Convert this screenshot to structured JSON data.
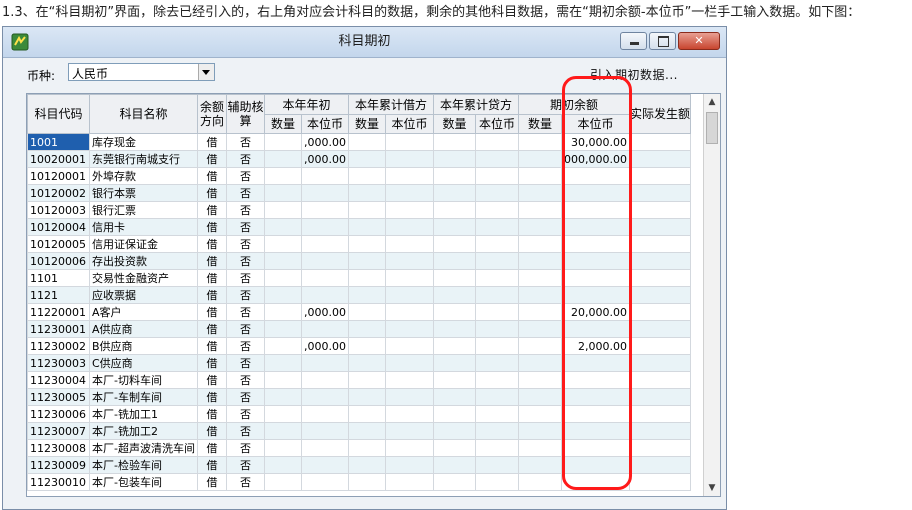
{
  "caption": "1.3、在“科目期初”界面，除去已经引入的，右上角对应会计科目的数据，剩余的其他科目数据，需在“期初余额-本位币”一栏手工输入数据。如下图：",
  "window": {
    "title": "科目期初",
    "buttons": {
      "minimize": "—",
      "maximize": "□",
      "close": "✕"
    }
  },
  "toolbar": {
    "currency_label": "币种:",
    "currency_value": "人民币",
    "import_link": "引入期初数据..."
  },
  "table": {
    "headers": {
      "code": "科目代码",
      "name": "科目名称",
      "direction": "余额方向",
      "aux": "辅助核算",
      "year_begin": "本年年初",
      "ytd_debit": "本年累计借方",
      "ytd_credit": "本年累计贷方",
      "opening": "期初余额",
      "actual": "实际发生额",
      "qty": "数量",
      "base": "本位币"
    },
    "rows": [
      {
        "code": "1001",
        "name": "库存现金",
        "dir": "借",
        "aux": "否",
        "yb": ",000.00",
        "ob": "30,000.00"
      },
      {
        "code": "10020001",
        "name": "东莞银行南城支行",
        "dir": "借",
        "aux": "否",
        "yb": ",000.00",
        "ob": "000,000.00"
      },
      {
        "code": "10120001",
        "name": "外埠存款",
        "dir": "借",
        "aux": "否",
        "yb": "",
        "ob": ""
      },
      {
        "code": "10120002",
        "name": "银行本票",
        "dir": "借",
        "aux": "否",
        "yb": "",
        "ob": ""
      },
      {
        "code": "10120003",
        "name": "银行汇票",
        "dir": "借",
        "aux": "否",
        "yb": "",
        "ob": ""
      },
      {
        "code": "10120004",
        "name": "信用卡",
        "dir": "借",
        "aux": "否",
        "yb": "",
        "ob": ""
      },
      {
        "code": "10120005",
        "name": "信用证保证金",
        "dir": "借",
        "aux": "否",
        "yb": "",
        "ob": ""
      },
      {
        "code": "10120006",
        "name": "存出投资款",
        "dir": "借",
        "aux": "否",
        "yb": "",
        "ob": ""
      },
      {
        "code": "1101",
        "name": "交易性金融资产",
        "dir": "借",
        "aux": "否",
        "yb": "",
        "ob": ""
      },
      {
        "code": "1121",
        "name": "应收票据",
        "dir": "借",
        "aux": "否",
        "yb": "",
        "ob": ""
      },
      {
        "code": "11220001",
        "name": "A客户",
        "dir": "借",
        "aux": "否",
        "yb": ",000.00",
        "ob": "20,000.00"
      },
      {
        "code": "11230001",
        "name": "A供应商",
        "dir": "借",
        "aux": "否",
        "yb": "",
        "ob": ""
      },
      {
        "code": "11230002",
        "name": "B供应商",
        "dir": "借",
        "aux": "否",
        "yb": ",000.00",
        "ob": "2,000.00"
      },
      {
        "code": "11230003",
        "name": "C供应商",
        "dir": "借",
        "aux": "否",
        "yb": "",
        "ob": ""
      },
      {
        "code": "11230004",
        "name": "本厂-切料车间",
        "dir": "借",
        "aux": "否",
        "yb": "",
        "ob": ""
      },
      {
        "code": "11230005",
        "name": "本厂-车制车间",
        "dir": "借",
        "aux": "否",
        "yb": "",
        "ob": ""
      },
      {
        "code": "11230006",
        "name": "本厂-铣加工1",
        "dir": "借",
        "aux": "否",
        "yb": "",
        "ob": ""
      },
      {
        "code": "11230007",
        "name": "本厂-铣加工2",
        "dir": "借",
        "aux": "否",
        "yb": "",
        "ob": ""
      },
      {
        "code": "11230008",
        "name": "本厂-超声波清洗车间",
        "dir": "借",
        "aux": "否",
        "yb": "",
        "ob": ""
      },
      {
        "code": "11230009",
        "name": "本厂-检验车间",
        "dir": "借",
        "aux": "否",
        "yb": "",
        "ob": ""
      },
      {
        "code": "11230010",
        "name": "本厂-包装车间",
        "dir": "借",
        "aux": "否",
        "yb": "",
        "ob": ""
      }
    ]
  },
  "colors": {
    "highlight": "#ff1a1a",
    "selection": "#1f5fae",
    "row_alt": "#e9f3f7"
  }
}
